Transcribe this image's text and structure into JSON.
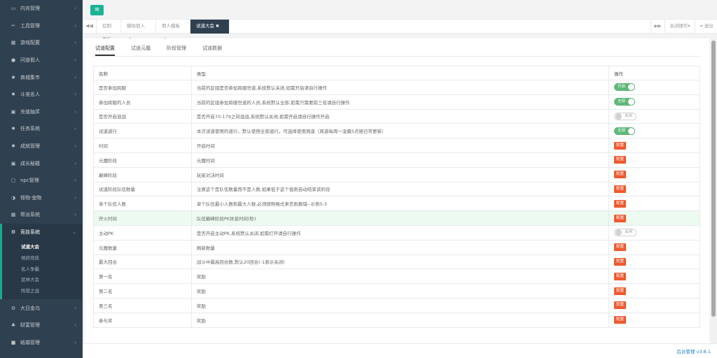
{
  "sidebar": {
    "items": [
      {
        "label": "内充管理",
        "icon": "monitor-icon",
        "glyph": "▭"
      },
      {
        "label": "工具管理",
        "icon": "tools-icon",
        "glyph": "✂"
      },
      {
        "label": "游戏配置",
        "icon": "grid-icon",
        "glyph": "▦"
      },
      {
        "label": "问道假人",
        "icon": "user-icon",
        "glyph": "●"
      },
      {
        "label": "商城集市",
        "icon": "gear-icon",
        "glyph": "✹"
      },
      {
        "label": "斗宠名人",
        "icon": "gear-icon",
        "glyph": "✹"
      },
      {
        "label": "充值抽奖",
        "icon": "ticket-icon",
        "glyph": "▣"
      },
      {
        "label": "任务系统",
        "icon": "gear-icon",
        "glyph": "✹"
      },
      {
        "label": "成就管理",
        "icon": "gear-icon",
        "glyph": "✹"
      },
      {
        "label": "成长秘籍",
        "icon": "book-icon",
        "glyph": "▣"
      },
      {
        "label": "npc管理",
        "icon": "npc-icon",
        "glyph": "▢"
      },
      {
        "label": "怪物·宠物",
        "icon": "half-circle-icon",
        "glyph": "◑"
      },
      {
        "label": "帮派系统",
        "icon": "grid-icon",
        "glyph": "▦"
      }
    ],
    "active": {
      "label": "竞技系统",
      "icon": "cogs-icon",
      "glyph": "⚙"
    },
    "sub_items": [
      "试道大会",
      "地府竞技",
      "名人争霸",
      "武林大会",
      "阵营之战"
    ],
    "current_sub": 0,
    "bottom_items": [
      {
        "label": "大日金乌",
        "icon": "cogs-icon",
        "glyph": "⚙"
      },
      {
        "label": "财富管理",
        "icon": "group-icon",
        "glyph": "♣"
      },
      {
        "label": "结婚管理",
        "icon": "square-icon",
        "glyph": "■"
      }
    ]
  },
  "topbar": {
    "menu_icon": "≡"
  },
  "tabs": [
    {
      "label": "控制面板",
      "close": ""
    },
    {
      "label": "模拟假人",
      "close": "⊙"
    },
    {
      "label": "假人模板",
      "close": "⊙"
    },
    {
      "label": "试道大会",
      "close": "✖"
    }
  ],
  "tabbar_left": "◀◀",
  "tabbar_right": {
    "forward": "▶▶",
    "close_ops": "关闭操作▾",
    "logout": "⇥ 退出"
  },
  "subtabs": [
    "试道配置",
    "试道元魔",
    "阶段管理",
    "试道数据"
  ],
  "table": {
    "headers": [
      "名称",
      "类型",
      "操作"
    ],
    "rows": [
      {
        "name": "是否参加跨服",
        "desc": "当前的区组是否参加跨服世道,系统默认关闭,如需开启请自行操作",
        "kind": "toggle",
        "on": true,
        "label": "开启"
      },
      {
        "name": "参加跨服的人员",
        "desc": "当前的区组参加跨服世道的人员,系统默认全部,如需只需要前三名请自行操作",
        "kind": "toggle",
        "on": true,
        "label": "全部"
      },
      {
        "name": "是否开启混战",
        "desc": "是否开启70-179之间混战,系统默认关闭,如需开启请自行操作开启",
        "kind": "toggle",
        "on": false,
        "label": "关闭"
      },
      {
        "name": "试道道行",
        "desc": "本次试道使用的道行，默认使用全部道行，可选择使用周道（周道每周一凌晨5点随日常更新）",
        "kind": "toggle",
        "on": true,
        "label": "全部"
      },
      {
        "name": "时间",
        "desc": "开启时间",
        "kind": "button",
        "label": "配置"
      },
      {
        "name": "元魔阶段",
        "desc": "元魔时间",
        "kind": "button",
        "label": "配置"
      },
      {
        "name": "巅峰阶段",
        "desc": "玩家对决时间",
        "kind": "button",
        "label": "配置"
      },
      {
        "name": "试道阶段队伍数量",
        "desc": "注意这个是队伍数量而不是人数,如果低于这个值则自动结束该阶段",
        "kind": "button",
        "label": "配置"
      },
      {
        "name": "单个队伍人数",
        "desc": "单个队伍最小人数和最大人数,必须按照格式来否则报错--示例5-5",
        "kind": "button",
        "label": "配置"
      },
      {
        "name": "开火时间",
        "desc": "队伍巅峰阶段PK休息时间(秒)",
        "kind": "button",
        "label": "配置",
        "highlight": true
      },
      {
        "name": "主动PK",
        "desc": "是否开启主动PK,系统默认关闭,如需打开请自行操作",
        "kind": "toggle",
        "on": false,
        "label": "关闭"
      },
      {
        "name": "元魔数量",
        "desc": "刷新数量",
        "kind": "button",
        "label": "配置"
      },
      {
        "name": "最大回合",
        "desc": "战斗中最高回合数,默认20回合(-1表示关闭)",
        "kind": "button",
        "label": "配置"
      },
      {
        "name": "第一名",
        "desc": "奖励",
        "kind": "button",
        "label": "配置"
      },
      {
        "name": "第二名",
        "desc": "奖励",
        "kind": "button",
        "label": "配置"
      },
      {
        "name": "第三名",
        "desc": "奖励",
        "kind": "button",
        "label": "配置"
      },
      {
        "name": "参与奖",
        "desc": "奖励",
        "kind": "button",
        "label": "配置"
      }
    ]
  },
  "footer": {
    "version": "后台管理 v3.8.1"
  },
  "colors": {
    "sidebar_bg": "#2f4050",
    "accent": "#1ab394",
    "toggle_on": "#5fb878",
    "config_btn": "#f0592f",
    "link": "#1c84c6"
  }
}
